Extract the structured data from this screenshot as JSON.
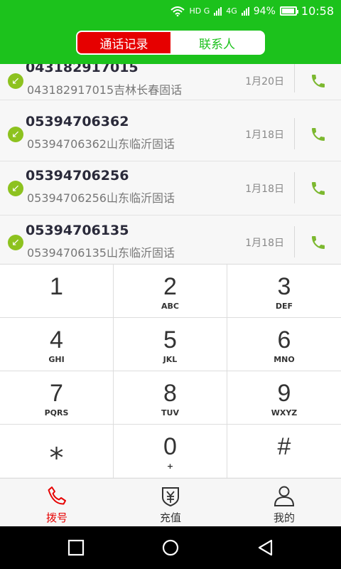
{
  "status": {
    "network1": "HD G",
    "network2": "4G",
    "battery_text": "94%",
    "battery_level": 0.94,
    "time": "10:58"
  },
  "header": {
    "tabs": [
      {
        "label": "通话记录",
        "active": true
      },
      {
        "label": "联系人",
        "active": false
      }
    ]
  },
  "call_log": [
    {
      "number": "043182917015",
      "description": "043182917015吉林长春固话",
      "date": "1月20日"
    },
    {
      "number": "05394706362",
      "description": "05394706362山东临沂固话",
      "date": "1月18日"
    },
    {
      "number": "05394706256",
      "description": "05394706256山东临沂固话",
      "date": "1月18日"
    },
    {
      "number": "05394706135",
      "description": "05394706135山东临沂固话",
      "date": "1月18日"
    }
  ],
  "dialpad": [
    {
      "digit": "1",
      "letters": ""
    },
    {
      "digit": "2",
      "letters": "ABC"
    },
    {
      "digit": "3",
      "letters": "DEF"
    },
    {
      "digit": "4",
      "letters": "GHI"
    },
    {
      "digit": "5",
      "letters": "JKL"
    },
    {
      "digit": "6",
      "letters": "MNO"
    },
    {
      "digit": "7",
      "letters": "PQRS"
    },
    {
      "digit": "8",
      "letters": "TUV"
    },
    {
      "digit": "9",
      "letters": "WXYZ"
    },
    {
      "digit": "⁎",
      "letters": ""
    },
    {
      "digit": "0",
      "letters": "+"
    },
    {
      "digit": "#",
      "letters": ""
    }
  ],
  "bottom_tabs": [
    {
      "label": "拨号",
      "icon": "phone-icon",
      "active": true
    },
    {
      "label": "充值",
      "icon": "yuan-shield-icon",
      "active": false
    },
    {
      "label": "我的",
      "icon": "user-icon",
      "active": false
    }
  ],
  "colors": {
    "brand_green": "#1cc21c",
    "active_red": "#e60000",
    "incoming_green": "#8dc21f"
  }
}
